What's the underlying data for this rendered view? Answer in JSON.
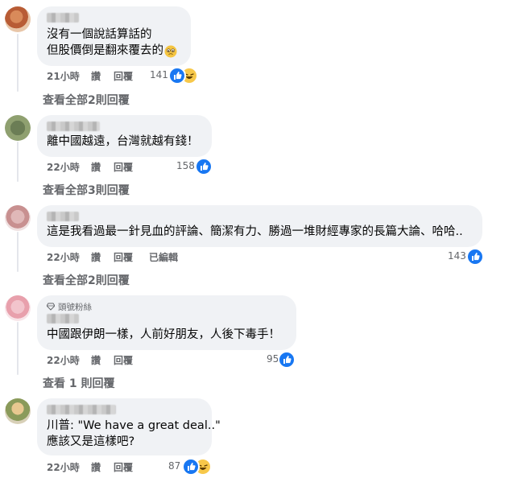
{
  "comments": [
    {
      "lines": [
        "沒有一個說話算話的",
        "但股價倒是翻來覆去的"
      ],
      "inline_emoji": "crying-face",
      "time": "21小時",
      "like": "讚",
      "reply": "回覆",
      "reaction_count": "141",
      "reactions": [
        "like",
        "haha"
      ],
      "view_replies": "查看全部2則回覆"
    },
    {
      "lines": [
        "離中國越遠，台灣就越有錢！"
      ],
      "time": "22小時",
      "like": "讚",
      "reply": "回覆",
      "reaction_count": "158",
      "reactions": [
        "like"
      ],
      "view_replies": "查看全部3則回覆"
    },
    {
      "lines": [
        "這是我看過最一針見血的評論、簡潔有力、勝過一堆財經專家的長篇大論、哈哈.."
      ],
      "time": "22小時",
      "like": "讚",
      "reply": "回覆",
      "edited": "已編輯",
      "reaction_count": "143",
      "reactions": [
        "like"
      ],
      "view_replies": "查看全部2則回覆"
    },
    {
      "badge": "頭號粉絲",
      "lines": [
        "中國跟伊朗一樣，人前好朋友，人後下毒手！"
      ],
      "time": "22小時",
      "like": "讚",
      "reply": "回覆",
      "reaction_count": "95",
      "reactions": [
        "like"
      ],
      "view_replies": "查看 1 則回覆"
    },
    {
      "lines": [
        "川普: \"We have a great deal..\"",
        "應該又是這樣吧?"
      ],
      "time": "22小時",
      "like": "讚",
      "reply": "回覆",
      "reaction_count": "87",
      "reactions": [
        "like",
        "haha"
      ]
    }
  ],
  "colors": {
    "bubble": "#f0f2f5",
    "meta": "#65676b",
    "like": "#1877f2",
    "haha": "#f7c84a"
  }
}
